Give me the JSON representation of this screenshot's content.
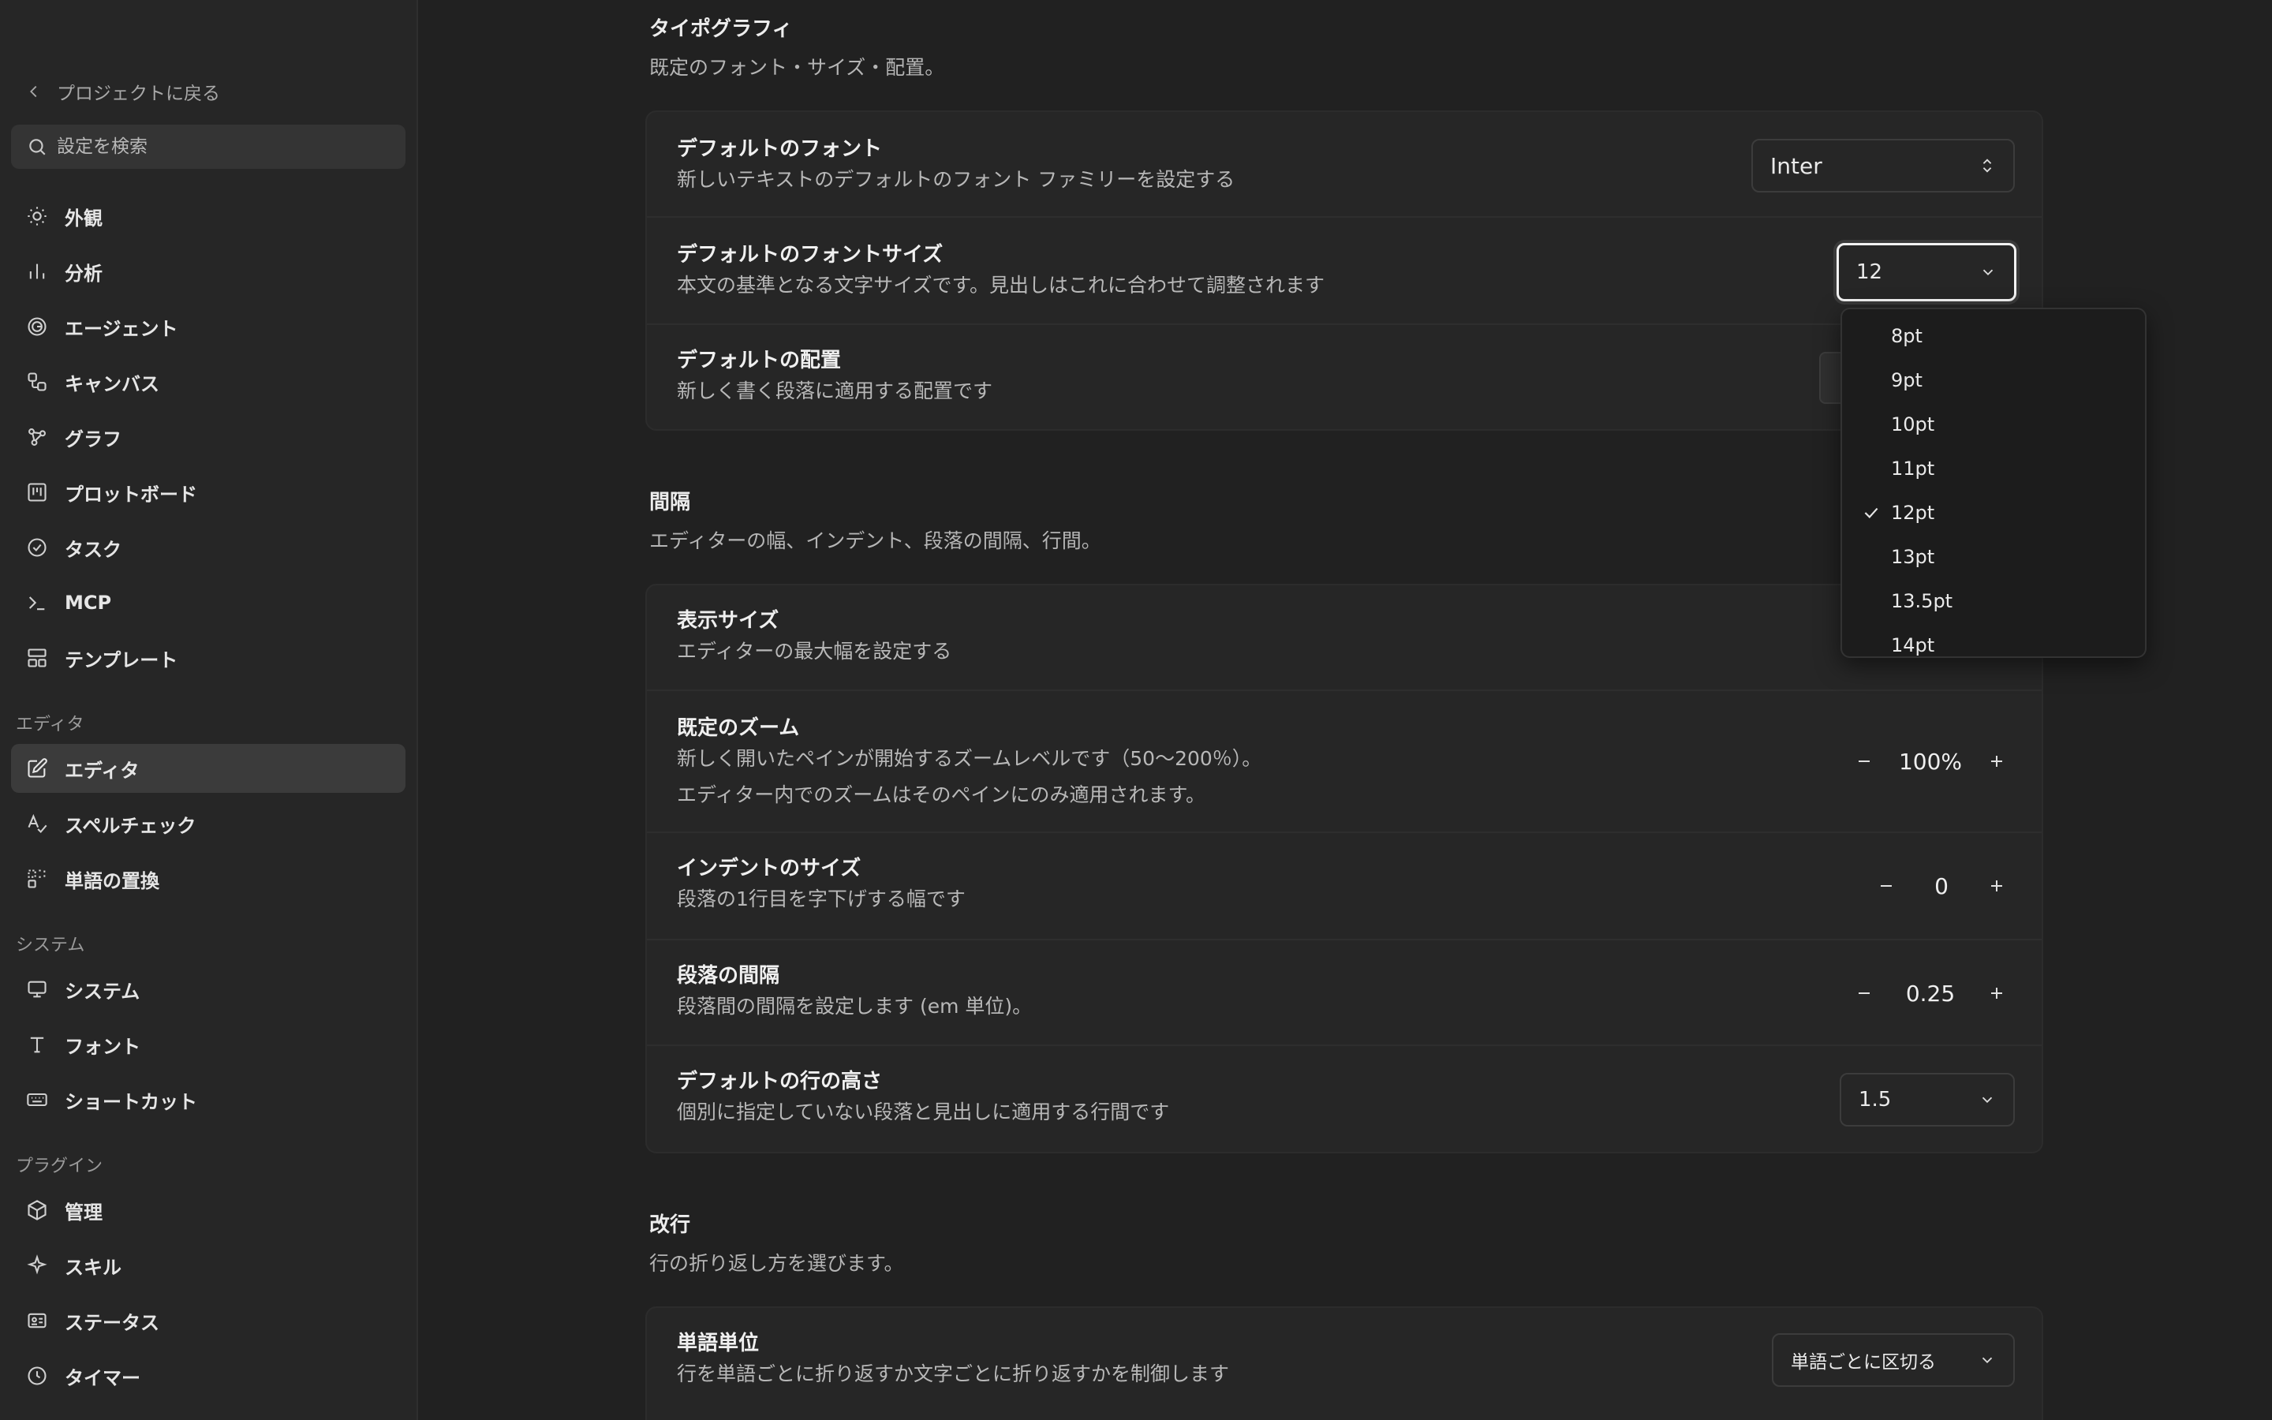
{
  "sidebar": {
    "back_label": "プロジェクトに戻る",
    "search_placeholder": "設定を検索",
    "items_top": [
      {
        "label": "外観",
        "icon": "sun-icon"
      },
      {
        "label": "分析",
        "icon": "bar-chart-icon"
      },
      {
        "label": "エージェント",
        "icon": "spiral-icon"
      },
      {
        "label": "キャンバス",
        "icon": "shapes-icon"
      },
      {
        "label": "グラフ",
        "icon": "graph-icon"
      },
      {
        "label": "プロットボード",
        "icon": "kanban-icon"
      },
      {
        "label": "タスク",
        "icon": "check-circle-icon"
      },
      {
        "label": "MCP",
        "icon": "terminal-icon"
      },
      {
        "label": "テンプレート",
        "icon": "layout-icon"
      }
    ],
    "section_editor": "エディタ",
    "items_editor": [
      {
        "label": "エディタ",
        "icon": "edit-icon",
        "active": true
      },
      {
        "label": "スペルチェック",
        "icon": "spellcheck-icon"
      },
      {
        "label": "単語の置換",
        "icon": "replace-icon"
      }
    ],
    "section_system": "システム",
    "items_system": [
      {
        "label": "システム",
        "icon": "monitor-icon"
      },
      {
        "label": "フォント",
        "icon": "type-icon"
      },
      {
        "label": "ショートカット",
        "icon": "keyboard-icon"
      }
    ],
    "section_plugins": "プラグイン",
    "items_plugins": [
      {
        "label": "管理",
        "icon": "package-icon"
      },
      {
        "label": "スキル",
        "icon": "sparkle-icon"
      },
      {
        "label": "ステータス",
        "icon": "id-card-icon"
      },
      {
        "label": "タイマー",
        "icon": "clock-icon"
      }
    ]
  },
  "typography": {
    "title": "タイポグラフィ",
    "subtitle": "既定のフォント・サイズ・配置。",
    "font": {
      "title": "デフォルトのフォント",
      "desc": "新しいテキストのデフォルトのフォント ファミリーを設定する",
      "value": "Inter"
    },
    "font_size": {
      "title": "デフォルトのフォントサイズ",
      "desc": "本文の基準となる文字サイズです。見出しはこれに合わせて調整されます",
      "value": "12"
    },
    "alignment": {
      "title": "デフォルトの配置",
      "desc": "新しく書く段落に適用する配置です"
    }
  },
  "spacing": {
    "title": "間隔",
    "subtitle": "エディターの幅、インデント、段落の間隔、行間。",
    "display_size": {
      "title": "表示サイズ",
      "desc": "エディターの最大幅を設定する"
    },
    "zoom": {
      "title": "既定のズーム",
      "desc1": "新しく開いたペインが開始するズームレベルです（50〜200％）。",
      "desc2": "エディター内でのズームはそのペインにのみ適用されます。",
      "value": "100%"
    },
    "indent": {
      "title": "インデントのサイズ",
      "desc": "段落の1行目を字下げする幅です",
      "value": "0"
    },
    "paragraph": {
      "title": "段落の間隔",
      "desc": "段落間の間隔を設定します (em 単位)。",
      "value": "0.25"
    },
    "line_height": {
      "title": "デフォルトの行の高さ",
      "desc": "個別に指定していない段落と見出しに適用する行間です",
      "value": "1.5"
    }
  },
  "linebreak": {
    "title": "改行",
    "subtitle": "行の折り返し方を選びます。",
    "word": {
      "title": "単語単位",
      "desc": "行を単語ごとに折り返すか文字ごとに折り返すかを制御します",
      "value": "単語ごとに区切る"
    }
  },
  "font_size_dropdown": {
    "options": [
      "8pt",
      "9pt",
      "10pt",
      "11pt",
      "12pt",
      "13pt",
      "13.5pt",
      "14pt"
    ],
    "selected": "12pt"
  }
}
